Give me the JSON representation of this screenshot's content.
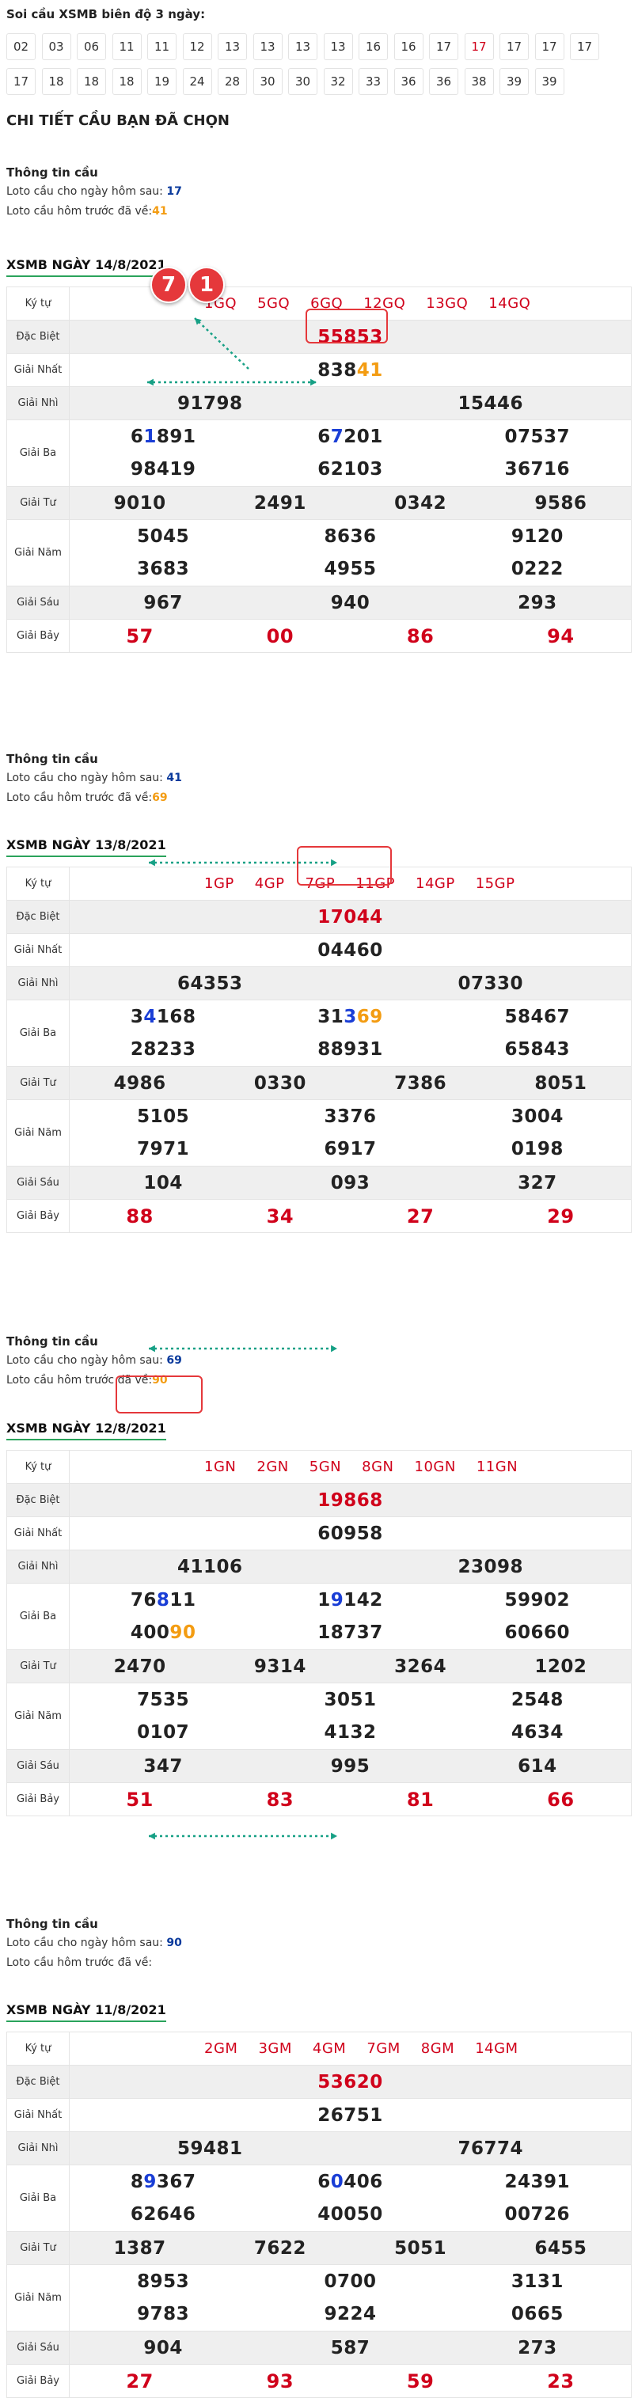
{
  "intro": "Soi cầu XSMB biên độ 3 ngày:",
  "chips_row1": [
    "02",
    "03",
    "06",
    "11",
    "11",
    "12",
    "13",
    "13",
    "13",
    "13",
    "16",
    "16",
    "17",
    "17",
    "17",
    "17",
    "17"
  ],
  "chips_row2": [
    "17",
    "18",
    "18",
    "18",
    "19",
    "24",
    "28",
    "30",
    "30",
    "32",
    "33",
    "36",
    "36",
    "38",
    "39",
    "39"
  ],
  "chips_red_index": 13,
  "heading": "CHI TIẾT CẦU BẠN ĐÃ CHỌN",
  "info_title": "Thông tin cầu",
  "info_next_label": "Loto cầu cho ngày hôm sau:",
  "info_prev_label": "Loto cầu hôm trước đã về:",
  "infos": [
    {
      "next": "17",
      "prev": "41"
    },
    {
      "next": "41",
      "prev": "69"
    },
    {
      "next": "69",
      "prev": "90"
    },
    {
      "next": "90",
      "prev": ""
    }
  ],
  "labels": {
    "kyhieu": "Ký tự",
    "db": "Đặc Biệt",
    "g1": "Giải Nhất",
    "g2": "Giải Nhì",
    "g3": "Giải Ba",
    "g4": "Giải Tư",
    "g5": "Giải Năm",
    "g6": "Giải Sáu",
    "g7": "Giải Bảy"
  },
  "badges": [
    "7",
    "1"
  ],
  "days": [
    {
      "title": "XSMB NGÀY 14/8/2021",
      "kyhieu": [
        "1GQ",
        "5GQ",
        "6GQ",
        "12GQ",
        "13GQ",
        "14GQ"
      ],
      "db": "55853",
      "g1": "83841",
      "g2": [
        "91798",
        "15446"
      ],
      "g3a": [
        "61891",
        "67201",
        "07537"
      ],
      "g3b": [
        "98419",
        "62103",
        "36716"
      ],
      "g4": [
        "9010",
        "2491",
        "0342",
        "9586"
      ],
      "g5a": [
        "5045",
        "8636",
        "9120"
      ],
      "g5b": [
        "3683",
        "4955",
        "0222"
      ],
      "g6": [
        "967",
        "940",
        "293"
      ],
      "g7": [
        "57",
        "00",
        "86",
        "94"
      ]
    },
    {
      "title": "XSMB NGÀY 13/8/2021",
      "kyhieu": [
        "1GP",
        "4GP",
        "7GP",
        "11GP",
        "14GP",
        "15GP"
      ],
      "db": "17044",
      "g1": "04460",
      "g2": [
        "64353",
        "07330"
      ],
      "g3a": [
        "34168",
        "31369",
        "58467"
      ],
      "g3b": [
        "28233",
        "88931",
        "65843"
      ],
      "g4": [
        "4986",
        "0330",
        "7386",
        "8051"
      ],
      "g5a": [
        "5105",
        "3376",
        "3004"
      ],
      "g5b": [
        "7971",
        "6917",
        "0198"
      ],
      "g6": [
        "104",
        "093",
        "327"
      ],
      "g7": [
        "88",
        "34",
        "27",
        "29"
      ]
    },
    {
      "title": "XSMB NGÀY 12/8/2021",
      "kyhieu": [
        "1GN",
        "2GN",
        "5GN",
        "8GN",
        "10GN",
        "11GN"
      ],
      "db": "19868",
      "g1": "60958",
      "g2": [
        "41106",
        "23098"
      ],
      "g3a": [
        "76811",
        "19142",
        "59902"
      ],
      "g3b": [
        "40090",
        "18737",
        "60660"
      ],
      "g4": [
        "2470",
        "9314",
        "3264",
        "1202"
      ],
      "g5a": [
        "7535",
        "3051",
        "2548"
      ],
      "g5b": [
        "0107",
        "4132",
        "4634"
      ],
      "g6": [
        "347",
        "995",
        "614"
      ],
      "g7": [
        "51",
        "83",
        "81",
        "66"
      ]
    },
    {
      "title": "XSMB NGÀY 11/8/2021",
      "kyhieu": [
        "2GM",
        "3GM",
        "4GM",
        "7GM",
        "8GM",
        "14GM"
      ],
      "db": "53620",
      "g1": "26751",
      "g2": [
        "59481",
        "76774"
      ],
      "g3a": [
        "89367",
        "60406",
        "24391"
      ],
      "g3b": [
        "62646",
        "40050",
        "00726"
      ],
      "g4": [
        "1387",
        "7622",
        "5051",
        "6455"
      ],
      "g5a": [
        "8953",
        "0700",
        "3131"
      ],
      "g5b": [
        "9783",
        "9224",
        "0665"
      ],
      "g6": [
        "904",
        "587",
        "273"
      ],
      "g7": [
        "27",
        "93",
        "59",
        "23"
      ]
    }
  ]
}
